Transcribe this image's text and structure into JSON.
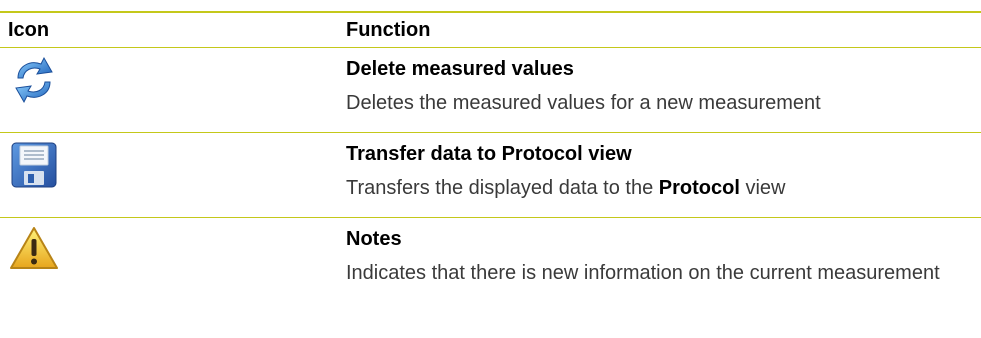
{
  "table": {
    "header": {
      "icon": "Icon",
      "function": "Function"
    },
    "rows": [
      {
        "icon": "refresh-arrows-icon",
        "title": "Delete measured values",
        "desc": "Deletes the measured values for a new measurement"
      },
      {
        "icon": "floppy-disk-icon",
        "title": "Transfer data to Protocol view",
        "desc_prefix": "Transfers the displayed data to the ",
        "desc_bold": "Protocol",
        "desc_suffix": " view"
      },
      {
        "icon": "warning-triangle-icon",
        "title": "Notes",
        "desc": "Indicates that there is new information on the current measurement"
      }
    ]
  },
  "colors": {
    "rule": "#c4c81a",
    "refresh_icon": "#2a79c8",
    "floppy_icon": "#3167b8",
    "warning_icon": "#f2c62a"
  }
}
